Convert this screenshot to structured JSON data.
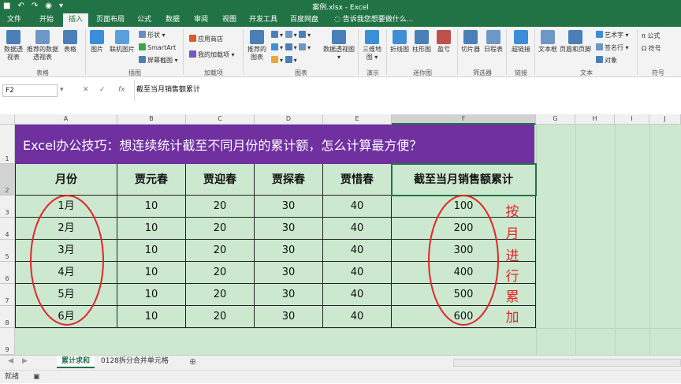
{
  "window": {
    "title": "案例.xlsx - Excel"
  },
  "tabs": [
    {
      "label": "文件",
      "active": false
    },
    {
      "label": "开始",
      "active": false
    },
    {
      "label": "插入",
      "active": true
    },
    {
      "label": "页面布局",
      "active": false
    },
    {
      "label": "公式",
      "active": false
    },
    {
      "label": "数据",
      "active": false
    },
    {
      "label": "审阅",
      "active": false
    },
    {
      "label": "视图",
      "active": false
    },
    {
      "label": "开发工具",
      "active": false
    },
    {
      "label": "百度网盘",
      "active": false
    }
  ],
  "tell_me": "告诉我您想要做什么...",
  "ribbon": {
    "groups": {
      "tables": "表格",
      "illustrations": "插图",
      "addins": "加载项",
      "charts": "图表",
      "tours": "演示",
      "sparklines": "迷你图",
      "filters": "筛选器",
      "links": "链接",
      "text": "文本",
      "symbols": "符号"
    },
    "buttons": {
      "pivot_table": "数据透视表",
      "recommended_pivot": "推荐的数据透视表",
      "table": "表格",
      "picture": "图片",
      "online_picture": "联机图片",
      "shapes": "形状",
      "smartart": "SmartArt",
      "screenshot": "屏幕截图",
      "store": "应用商店",
      "my_addins": "我的加载项",
      "recommended_charts": "推荐的图表",
      "pivot_chart": "数据透视图",
      "map_3d": "三维地图",
      "line": "折线图",
      "column": "柱形图",
      "winloss": "盈亏",
      "slicer": "切片器",
      "timeline": "日程表",
      "hyperlink": "超链接",
      "textbox": "文本框",
      "header_footer": "页眉和页脚",
      "wordart": "艺术字",
      "signature": "签名行",
      "object": "对象",
      "equation": "公式",
      "symbol": "符号"
    }
  },
  "formula_bar": {
    "name_box": "F2",
    "fx": "fx",
    "content": "截至当月销售额累计"
  },
  "columns": [
    "A",
    "B",
    "C",
    "D",
    "E",
    "F",
    "G",
    "H",
    "I",
    "J"
  ],
  "rows": [
    "1",
    "2",
    "3",
    "4",
    "5",
    "6",
    "7",
    "8",
    "9"
  ],
  "sheet": {
    "banner": "Excel办公技巧：想连续统计截至不同月份的累计额，怎么计算最方便？",
    "headers": [
      "月份",
      "贾元春",
      "贾迎春",
      "贾探春",
      "贾惜春",
      "截至当月销售额累计"
    ],
    "rows": [
      [
        "1月",
        "10",
        "20",
        "30",
        "40",
        "100"
      ],
      [
        "2月",
        "10",
        "20",
        "30",
        "40",
        "200"
      ],
      [
        "3月",
        "10",
        "20",
        "30",
        "40",
        "300"
      ],
      [
        "4月",
        "10",
        "20",
        "30",
        "40",
        "400"
      ],
      [
        "5月",
        "10",
        "20",
        "30",
        "40",
        "500"
      ],
      [
        "6月",
        "10",
        "20",
        "30",
        "40",
        "600"
      ]
    ],
    "annotation": [
      "按",
      "月",
      "进",
      "行",
      "累",
      "加"
    ]
  },
  "sheet_tabs": [
    {
      "label": "累计求和",
      "active": true
    },
    {
      "label": "0128拆分合并单元格",
      "active": false
    }
  ],
  "status": {
    "ready": "就绪"
  },
  "colors": {
    "excel_green": "#217346",
    "banner_purple": "#7030a0",
    "sheet_green": "#cce8cf",
    "annotation_red": "#e3262a"
  }
}
